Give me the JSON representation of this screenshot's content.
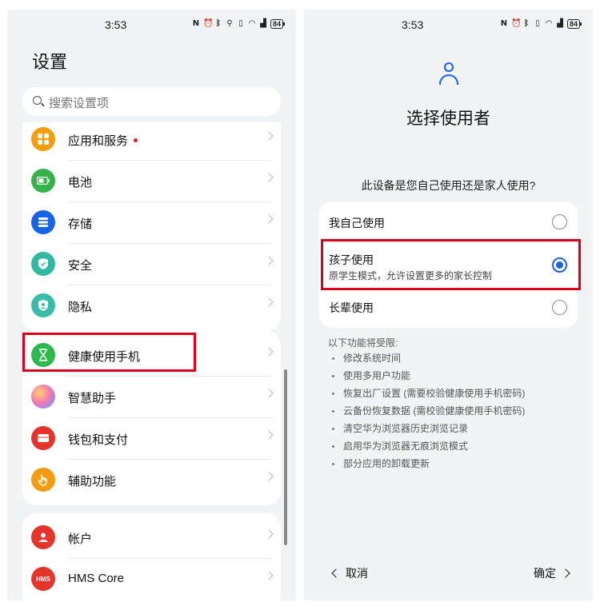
{
  "status": {
    "time": "3:53",
    "battery": "84"
  },
  "left": {
    "title": "设置",
    "search": {
      "placeholder": "搜索设置项"
    },
    "items": [
      {
        "label": "应用和服务",
        "icon": "apps-icon",
        "color": "#f59d0d",
        "badge": true
      },
      {
        "label": "电池",
        "icon": "battery-icon",
        "color": "#36b24a"
      },
      {
        "label": "存储",
        "icon": "storage-icon",
        "color": "#1763e6"
      },
      {
        "label": "安全",
        "icon": "shield-icon",
        "color": "#31b9a3"
      },
      {
        "label": "隐私",
        "icon": "privacy-icon",
        "color": "#3bbba9"
      },
      {
        "label": "健康使用手机",
        "icon": "hourglass-icon",
        "color": "#2eb84d"
      },
      {
        "label": "智慧助手",
        "icon": "assistant-icon",
        "color": "#b58cf0"
      },
      {
        "label": "钱包和支付",
        "icon": "wallet-icon",
        "color": "#e5342a"
      },
      {
        "label": "辅助功能",
        "icon": "hand-icon",
        "color": "#f39b11"
      },
      {
        "label": "帐户",
        "icon": "account-icon",
        "color": "#e5342a"
      },
      {
        "label": "HMS Core",
        "icon": "hms-icon",
        "color": "#e5342a",
        "icon_text": "HMS"
      }
    ]
  },
  "right": {
    "title": "选择使用者",
    "question": "此设备是您自己使用还是家人使用?",
    "options": [
      {
        "label": "我自己使用",
        "checked": false
      },
      {
        "label": "孩子使用",
        "sub": "原学生模式，允许设置更多的家长控制",
        "checked": true
      },
      {
        "label": "长辈使用",
        "checked": false
      }
    ],
    "restrict_title": "以下功能将受限:",
    "restrictions": [
      "修改系统时间",
      "使用多用户功能",
      "恢复出厂设置 (需要校验健康使用手机密码)",
      "云备份恢复数据 (需校验健康使用手机密码)",
      "清空华为浏览器历史浏览记录",
      "启用华为浏览器无痕浏览模式",
      "部分应用的卸载更新"
    ],
    "cancel": "取消",
    "confirm": "确定"
  },
  "colors": {
    "accent": "#1a5ff2",
    "highlight": "#d9001b"
  }
}
